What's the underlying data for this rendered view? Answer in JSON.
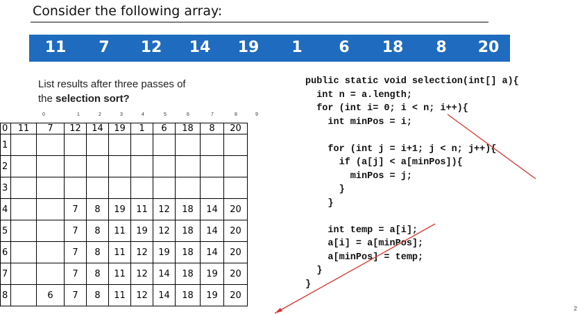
{
  "title": "Consider the following array:",
  "array": [
    "11",
    "7",
    "12",
    "14",
    "19",
    "1",
    "6",
    "18",
    "8",
    "20"
  ],
  "prompt": {
    "line1": "List results after three passes of",
    "line2_prefix": "the ",
    "line2_bold": "selection sort?"
  },
  "indices": [
    "0",
    "1",
    "2",
    "3",
    "4",
    "5",
    "6",
    "7",
    "8",
    "9"
  ],
  "rows": [
    {
      "label": "0",
      "cells": [
        "11",
        "7",
        "12",
        "14",
        "19",
        "1",
        "6",
        "18",
        "8",
        "20"
      ]
    },
    {
      "label": "1",
      "cells": [
        "",
        "",
        "",
        "",
        "",
        "",
        "",
        "",
        "",
        ""
      ]
    },
    {
      "label": "2",
      "cells": [
        "",
        "",
        "",
        "",
        "",
        "",
        "",
        "",
        "",
        ""
      ]
    },
    {
      "label": "3",
      "cells": [
        "",
        "",
        "",
        "",
        "",
        "",
        "",
        "",
        "",
        ""
      ]
    },
    {
      "label": "4",
      "cells": [
        "",
        "",
        "7",
        "8",
        "19",
        "11",
        "12",
        "18",
        "14",
        "20"
      ]
    },
    {
      "label": "5",
      "cells": [
        "",
        "",
        "7",
        "8",
        "11",
        "19",
        "12",
        "18",
        "14",
        "20"
      ]
    },
    {
      "label": "6",
      "cells": [
        "",
        "",
        "7",
        "8",
        "11",
        "12",
        "19",
        "18",
        "14",
        "20"
      ]
    },
    {
      "label": "7",
      "cells": [
        "",
        "",
        "7",
        "8",
        "11",
        "12",
        "14",
        "18",
        "19",
        "20"
      ]
    },
    {
      "label": "8",
      "cells": [
        "",
        "6",
        "7",
        "8",
        "11",
        "12",
        "14",
        "18",
        "19",
        "20"
      ]
    }
  ],
  "code": [
    "public static void selection(int[] a){",
    "  int n = a.length;",
    "  for (int i= 0; i < n; i++){",
    "    int minPos = i;",
    "",
    "    for (int j = i+1; j < n; j++){",
    "      if (a[j] < a[minPos]){",
    "        minPos = j;",
    "      }",
    "    }",
    "",
    "    int temp = a[i];",
    "    a[i] = a[minPos];",
    "    a[minPos] = temp;",
    "  }",
    "}"
  ],
  "page_number": "2",
  "colors": {
    "array_bar": "#1f6bbf",
    "annotation": "#d9352c"
  }
}
